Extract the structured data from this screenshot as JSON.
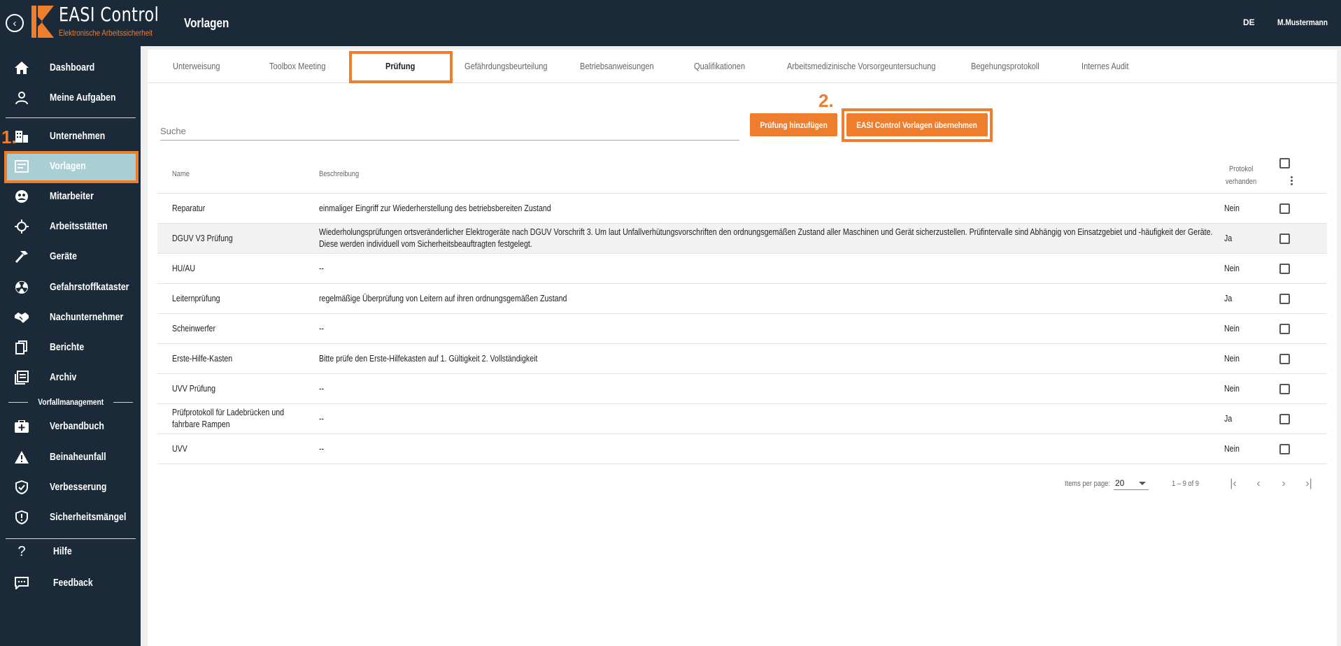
{
  "header": {
    "logo_title": "EASI Control",
    "logo_subtitle": "Elektronische Arbeitssicherheit",
    "page_title": "Vorlagen",
    "language": "DE",
    "user": "M.Mustermann"
  },
  "colors": {
    "accent": "#ef7d2e",
    "dark": "#1a2a38",
    "active_nav": "#a9cfd5"
  },
  "annotations": {
    "step1": "1.",
    "step2": "2."
  },
  "sidebar": {
    "items": [
      {
        "label": "Dashboard",
        "icon": "home-icon"
      },
      {
        "label": "Meine Aufgaben",
        "icon": "person-icon"
      },
      {
        "label": "Unternehmen",
        "icon": "building-icon"
      },
      {
        "label": "Vorlagen",
        "icon": "template-icon",
        "active": true
      },
      {
        "label": "Mitarbeiter",
        "icon": "people-icon"
      },
      {
        "label": "Arbeitsstätten",
        "icon": "crosshair-icon"
      },
      {
        "label": "Geräte",
        "icon": "hammer-icon"
      },
      {
        "label": "Gefahrstoffkataster",
        "icon": "radiation-icon"
      },
      {
        "label": "Nachunternehmer",
        "icon": "handshake-icon"
      },
      {
        "label": "Berichte",
        "icon": "documents-icon"
      },
      {
        "label": "Archiv",
        "icon": "archive-icon"
      }
    ],
    "section_title": "Vorfallmanagement",
    "incident_items": [
      {
        "label": "Verbandbuch",
        "icon": "first-aid-icon"
      },
      {
        "label": "Beinaheunfall",
        "icon": "warning-icon"
      },
      {
        "label": "Verbesserung",
        "icon": "shield-check-icon"
      },
      {
        "label": "Sicherheitsmängel",
        "icon": "shield-alert-icon"
      }
    ],
    "footer_items": [
      {
        "label": "Hilfe",
        "icon": "question-icon"
      },
      {
        "label": "Feedback",
        "icon": "feedback-icon"
      }
    ]
  },
  "tabs": [
    "Unterweisung",
    "Toolbox Meeting",
    "Prüfung",
    "Gefährdungsbeurteilung",
    "Betriebsanweisungen",
    "Qualifikationen",
    "Arbeitsmedizinische Vorsorgeuntersuchung",
    "Begehungsprotokoll",
    "Internes Audit"
  ],
  "active_tab": "Prüfung",
  "search": {
    "placeholder": "Suche",
    "value": ""
  },
  "buttons": {
    "add": "Prüfung hinzufügen",
    "adopt": "EASI Control Vorlagen übernehmen"
  },
  "table": {
    "columns": {
      "name": "Name",
      "description": "Beschreibung",
      "protocol_line1": "Protokol",
      "protocol_line2": "verhanden"
    },
    "rows": [
      {
        "name": "Reparatur",
        "description": "einmaliger Eingriff zur Wiederherstellung des betriebsbereiten Zustand",
        "protocol": "Nein"
      },
      {
        "name": "DGUV V3 Prüfung",
        "description": "Wiederholungsprüfungen ortsveränderlicher Elektrogeräte nach DGUV Vorschrift 3. Um laut Unfallverhütungsvorschriften den ordnungsgemäßen Zustand aller Maschinen und Gerät sicherzustellen. Prüfintervalle sind Abhängig von Einsatzgebiet und -häufigkeit der Geräte. Diese werden individuell vom Sicherheitsbeauftragten festgelegt.",
        "protocol": "Ja"
      },
      {
        "name": "HU/AU",
        "description": "--",
        "protocol": "Nein"
      },
      {
        "name": "Leiternprüfung",
        "description": "regelmäßige Überprüfung von Leitern auf ihren ordnungsgemäßen Zustand",
        "protocol": "Ja"
      },
      {
        "name": "Scheinwerfer",
        "description": "--",
        "protocol": "Nein"
      },
      {
        "name": "Erste-Hilfe-Kasten",
        "description": "Bitte prüfe den Erste-Hilfekasten auf 1. Gültigkeit 2. Vollständigkeit",
        "protocol": "Nein"
      },
      {
        "name": "UVV Prüfung",
        "description": "--",
        "protocol": "Nein"
      },
      {
        "name": "Prüfprotokoll für Ladebrücken und fahrbare Rampen",
        "description": "--",
        "protocol": "Ja"
      },
      {
        "name": "UVV",
        "description": "--",
        "protocol": "Nein"
      }
    ]
  },
  "paginator": {
    "items_per_page_label": "Items per page:",
    "page_size": "20",
    "range": "1 – 9 of 9"
  }
}
